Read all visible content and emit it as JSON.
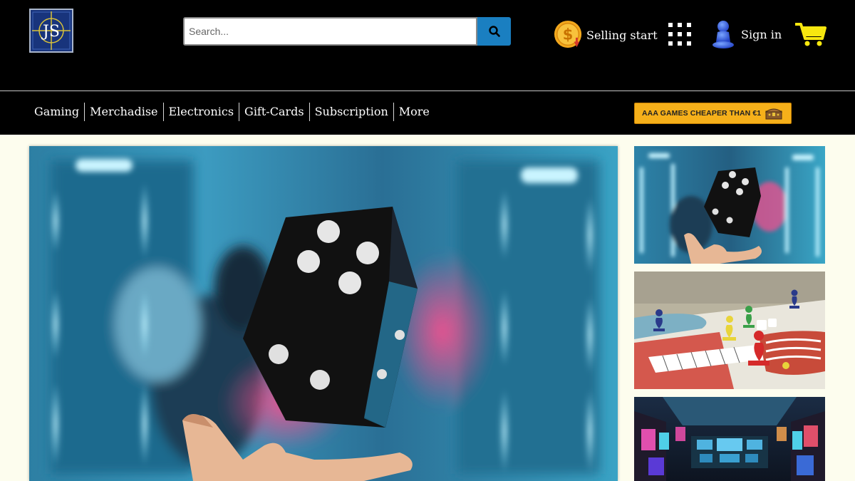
{
  "logo": {
    "text": "JS"
  },
  "search": {
    "placeholder": "Search...",
    "value": "",
    "button_icon": "search-icon"
  },
  "header_actions": {
    "selling_label": "Selling start",
    "selling_icon": "dollar-coin-icon",
    "apps_icon": "grid-icon",
    "signin_label": "Sign in",
    "signin_icon": "user-icon",
    "cart_icon": "cart-icon"
  },
  "nav": {
    "items": [
      "Gaming",
      "Merchadise",
      "Electronics",
      "Gift-Cards",
      "Subscription",
      "More"
    ]
  },
  "promo": {
    "text": "AAA GAMES CHEAPER THAN €1",
    "icon": "treasure-chest-icon"
  },
  "colors": {
    "header_bg": "#000000",
    "page_bg": "#fdfdee",
    "search_button": "#1a7fc1",
    "promo_bg": "#f6b01a",
    "cart": "#f7e70f"
  },
  "images": {
    "hero": "hero-dice-image",
    "thumbs": [
      "dice-thumbnail",
      "board-game-thumbnail",
      "arcade-room-thumbnail"
    ]
  }
}
